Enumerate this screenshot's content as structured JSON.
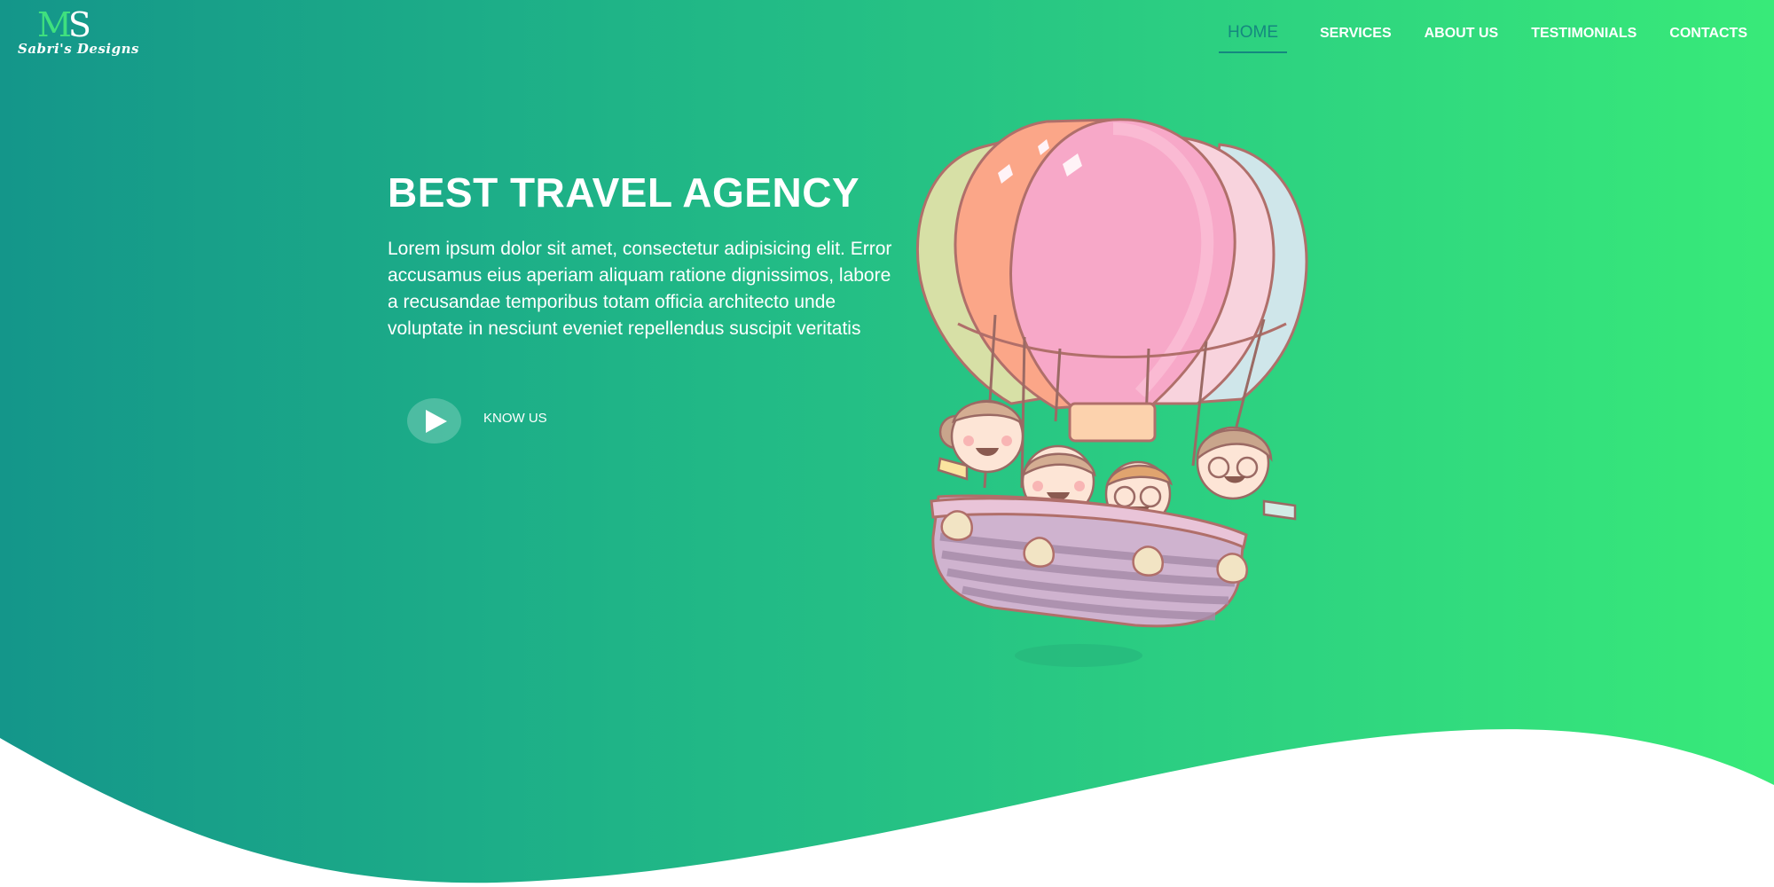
{
  "logo": {
    "mark_m": "M",
    "mark_s": "S",
    "text": "Sabri's Designs"
  },
  "nav": {
    "items": [
      {
        "label": "HOME",
        "active": true
      },
      {
        "label": "SERVICES",
        "active": false
      },
      {
        "label": "ABOUT US",
        "active": false
      },
      {
        "label": "TESTIMONIALS",
        "active": false
      },
      {
        "label": "CONTACTS",
        "active": false
      }
    ]
  },
  "hero": {
    "title": "BEST TRAVEL AGENCY",
    "paragraph": "Lorem ipsum dolor sit amet, consectetur adipisicing elit. Error accusamus eius aperiam aliquam ratione dignissimos, labore a recusandae temporibus totam officia architecto unde voluptate in nesciunt eveniet repellendus suscipit veritatis",
    "cta_label": "KNOW US",
    "cta_icon": "play-icon",
    "illustration": "hot-air-balloon-with-family"
  },
  "colors": {
    "gradient_start": "#14968a",
    "gradient_end": "#38ea79",
    "active_nav": "#15887f",
    "text": "#ffffff",
    "wave": "#ffffff"
  }
}
